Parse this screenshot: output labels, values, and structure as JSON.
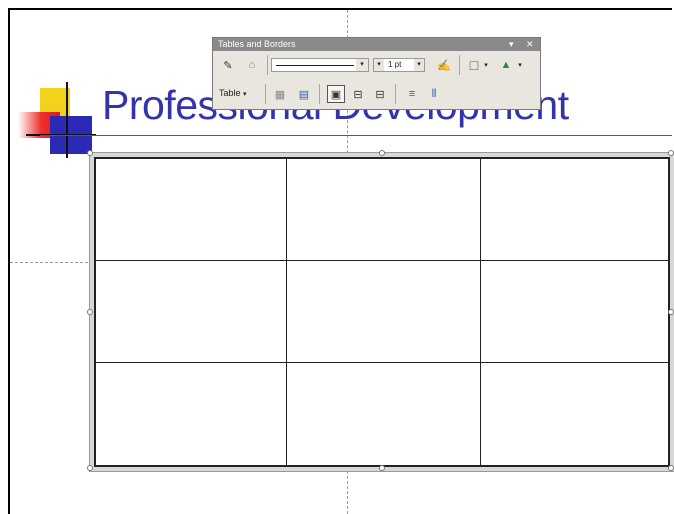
{
  "slide": {
    "title": "Professional Development"
  },
  "toolbar": {
    "title": "Tables and Borders",
    "menu_glyph": "▾",
    "close_glyph": "✕",
    "line_weight": "1 pt",
    "table_menu_label": "Table",
    "dropdown_glyph": "▾",
    "row1_buttons": [
      {
        "name": "draw-table-pencil-icon",
        "glyph": "✎"
      },
      {
        "name": "eraser-icon",
        "glyph": "⌂"
      },
      {
        "name": "border-color-pen-icon",
        "glyph": "✍"
      },
      {
        "name": "outside-border-icon",
        "glyph": "□"
      },
      {
        "name": "fill-color-bucket-icon",
        "glyph": "▲"
      }
    ],
    "row2_buttons": [
      {
        "name": "insert-table-icon",
        "glyph": "▦"
      },
      {
        "name": "merge-cells-icon",
        "glyph": "▤"
      },
      {
        "name": "split-cells-icon",
        "glyph": "▣"
      },
      {
        "name": "align-top-icon",
        "glyph": "⊟"
      },
      {
        "name": "align-bottom-icon",
        "glyph": "⊟"
      },
      {
        "name": "distribute-rows-icon",
        "glyph": "≡"
      },
      {
        "name": "distribute-columns-icon",
        "glyph": "⫴"
      }
    ]
  },
  "table": {
    "rows": 3,
    "columns": 3
  },
  "colors": {
    "title": "#3333aa",
    "toolbar_bg": "#e8e6df",
    "toolbar_titlebar": "#8a8a8a"
  }
}
